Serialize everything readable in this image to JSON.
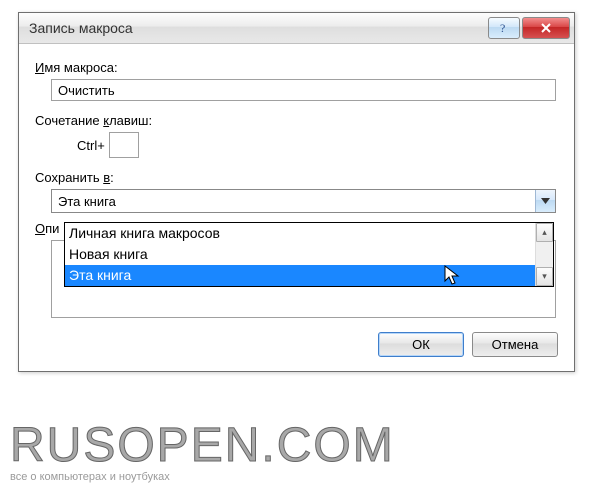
{
  "dialog": {
    "title": "Запись макроса",
    "name_label_pre": "",
    "name_label_u": "И",
    "name_label_post": "мя макроса:",
    "name_value": "Очистить",
    "shortcut_label_pre": "Сочетание ",
    "shortcut_label_u": "к",
    "shortcut_label_post": "лавиш:",
    "ctrl_text": "Ctrl+",
    "shortcut_key": "",
    "save_label_pre": "Сохранить ",
    "save_label_u": "в",
    "save_label_post": ":",
    "save_selected": "Эта книга",
    "desc_label_pre": "",
    "desc_label_u": "О",
    "desc_label_mid": "п",
    "desc_label_post": "и",
    "ok": "ОК",
    "cancel": "Отмена"
  },
  "dropdown": {
    "items": [
      "Личная книга макросов",
      "Новая книга",
      "Эта книга"
    ],
    "selected_index": 2
  },
  "watermark": {
    "main": "RUSOPEN.COM",
    "sub": "все о компьютерах и ноутбуках"
  }
}
